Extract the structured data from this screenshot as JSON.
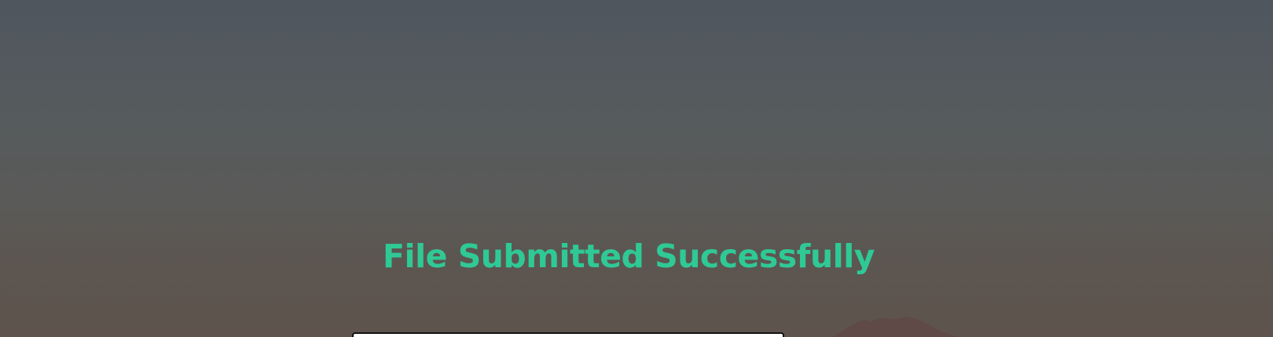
{
  "status": {
    "title": "File Submitted Successfully"
  },
  "colors": {
    "success_text": "#2fc996",
    "mountain": "#5f4a48",
    "card_border": "#111111"
  }
}
